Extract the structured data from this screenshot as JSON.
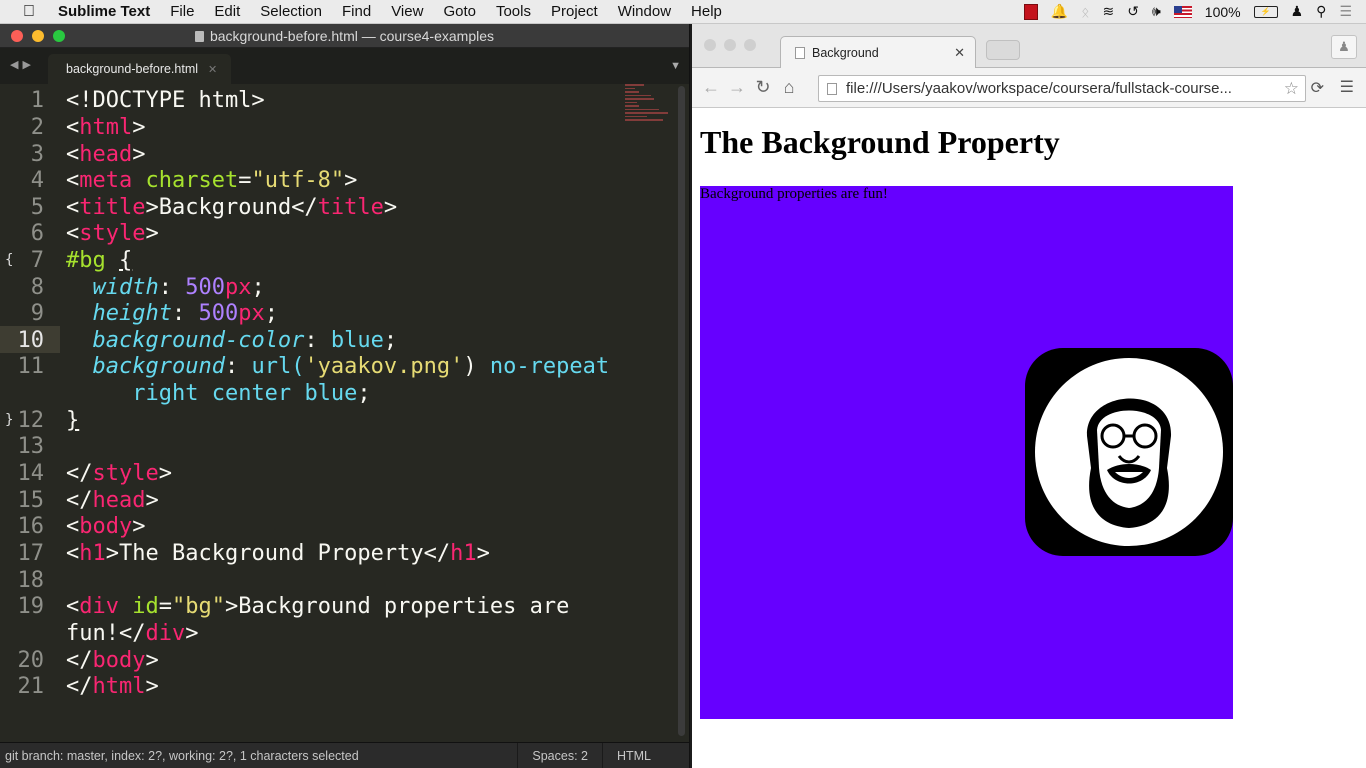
{
  "menubar": {
    "app": "Sublime Text",
    "items": [
      "File",
      "Edit",
      "Selection",
      "Find",
      "View",
      "Goto",
      "Tools",
      "Project",
      "Window",
      "Help"
    ],
    "battery": "100%"
  },
  "sublime": {
    "window_title": "background-before.html — course4-examples",
    "tab": "background-before.html",
    "lines": [
      {
        "n": "1"
      },
      {
        "n": "2"
      },
      {
        "n": "3"
      },
      {
        "n": "4"
      },
      {
        "n": "5"
      },
      {
        "n": "6"
      },
      {
        "n": "7"
      },
      {
        "n": "8"
      },
      {
        "n": "9"
      },
      {
        "n": "10"
      },
      {
        "n": "11"
      },
      {
        "n": "12"
      },
      {
        "n": "13"
      },
      {
        "n": "14"
      },
      {
        "n": "15"
      },
      {
        "n": "16"
      },
      {
        "n": "17"
      },
      {
        "n": "18"
      },
      {
        "n": "19"
      },
      {
        "n": "20"
      },
      {
        "n": "21"
      }
    ],
    "code": {
      "l1": "<!DOCTYPE html>",
      "html": "html",
      "head": "head",
      "meta": "meta",
      "charset": "charset",
      "utf8": "\"utf-8\"",
      "title": "title",
      "title_text": "Background",
      "style": "style",
      "selector": "#bg",
      "brace_open": "{",
      "brace_close": "}",
      "width": "width",
      "height": "height",
      "bgcolor": "background-color",
      "background": "background",
      "v500": "500",
      "px": "px",
      "blue": "blue",
      "url": "url(",
      "png": "'yaakov.png'",
      "norepeat": "no-repeat",
      "rightcenter": "right center",
      "body": "body",
      "h1": "h1",
      "h1_text": "The Background Property",
      "div": "div",
      "id": "id",
      "bgid": "\"bg\"",
      "div_text1": "Background properties are",
      "div_text2": "fun!"
    },
    "status": {
      "git": "git branch: master, index: 2?, working: 2?, 1 characters selected",
      "spaces": "Spaces: 2",
      "syntax": "HTML"
    }
  },
  "chrome": {
    "tab_title": "Background",
    "url": "file:///Users/yaakov/workspace/coursera/fullstack-course...",
    "page": {
      "heading": "The Background Property",
      "div_text": "Background properties are fun!",
      "bg_color": "#6600ff"
    }
  },
  "colors": {
    "tag": "#f92672",
    "attr": "#a6e22e",
    "string": "#e6db74",
    "number": "#ae81ff",
    "property": "#66d9ef"
  }
}
